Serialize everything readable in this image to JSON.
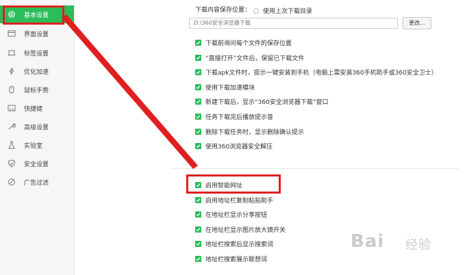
{
  "sidebar": {
    "items": [
      {
        "label": "基本设置",
        "icon": "gear-icon",
        "active": true
      },
      {
        "label": "界面设置",
        "icon": "window-icon"
      },
      {
        "label": "标签设置",
        "icon": "tab-icon"
      },
      {
        "label": "优化加速",
        "icon": "lightning-icon"
      },
      {
        "label": "鼠标手势",
        "icon": "mouse-icon"
      },
      {
        "label": "快捷键",
        "icon": "keyboard-icon"
      },
      {
        "label": "高级设置",
        "icon": "wrench-icon"
      },
      {
        "label": "实验室",
        "icon": "flask-icon"
      },
      {
        "label": "安全设置",
        "icon": "shield-icon"
      },
      {
        "label": "广告过滤",
        "icon": "block-icon"
      }
    ]
  },
  "download": {
    "location_label": "下载内容保存位置：",
    "radio_last_dir": "使用上次下载目录",
    "path_value": "D:\\360安全浏览器下载",
    "change_button": "更改..."
  },
  "options": [
    {
      "label": "下载前询问每个文件的保存位置",
      "checked": true
    },
    {
      "label": "“直接打开”文件后，保留已下载文件",
      "checked": true
    },
    {
      "label": "下载apk文件时，提示一键安装到手机（电脑上需安装360手机助手或360安全卫士）",
      "checked": true
    },
    {
      "label": "使用下载加速模块",
      "checked": true
    },
    {
      "label": "新建下载后，显示“360安全浏览器下载”窗口",
      "checked": true
    },
    {
      "label": "任务下载完后播放提示音",
      "checked": true
    },
    {
      "label": "删除下载任务时，显示删除确认提示",
      "checked": true
    },
    {
      "label": "使用360浏览器安全解压",
      "checked": true
    }
  ],
  "address_options": [
    {
      "label": "启用智能网址",
      "checked": true
    },
    {
      "label": "启用地址栏复制粘贴助手",
      "checked": true
    },
    {
      "label": "在地址栏显示分享按钮",
      "checked": true
    },
    {
      "label": "在地址栏显示图片放大镜开关",
      "checked": true
    },
    {
      "label": "地址栏搜索后显示搜索词",
      "checked": true
    },
    {
      "label": "地址栏搜索展示联想词",
      "checked": true
    }
  ],
  "watermark": {
    "text": "Bai",
    "sub": "经验"
  },
  "colors": {
    "accent": "#2bbd5b",
    "annotation": "#e02020"
  }
}
